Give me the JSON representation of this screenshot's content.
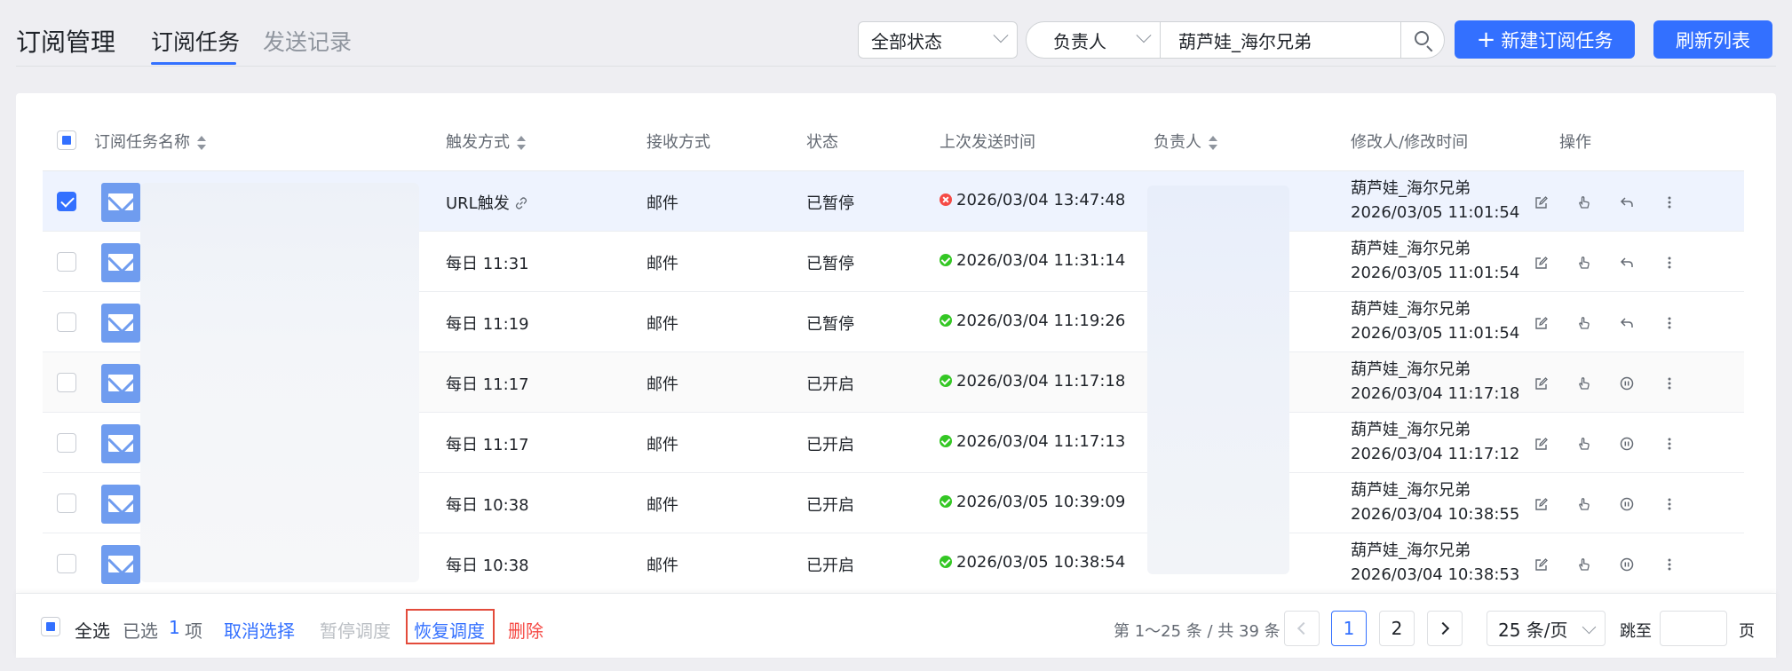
{
  "header": {
    "app_title": "订阅管理",
    "tabs": [
      {
        "label": "订阅任务",
        "active": true
      },
      {
        "label": "发送记录",
        "active": false
      }
    ]
  },
  "filters": {
    "status_select": "全部状态",
    "owner_select": "负责人",
    "owner_value": "葫芦娃_海尔兄弟",
    "new_button": "新建订阅任务",
    "new_button_icon": "plus-icon",
    "refresh_button": "刷新列表"
  },
  "table": {
    "columns": [
      "订阅任务名称",
      "触发方式",
      "接收方式",
      "状态",
      "上次发送时间",
      "负责人",
      "修改人/修改时间",
      "操作"
    ],
    "rows": [
      {
        "checked": true,
        "trigger": "URL触发",
        "receive": "邮件",
        "status": "已暂停",
        "last_send_ok": false,
        "last_send": "2026/03/04 13:47:48",
        "modifier": "葫芦娃_海尔兄弟",
        "modified": "2026/03/05 11:01:54",
        "action3": "resume"
      },
      {
        "checked": false,
        "trigger": "每日 11:31",
        "receive": "邮件",
        "status": "已暂停",
        "last_send_ok": true,
        "last_send": "2026/03/04 11:31:14",
        "modifier": "葫芦娃_海尔兄弟",
        "modified": "2026/03/05 11:01:54",
        "action3": "resume"
      },
      {
        "checked": false,
        "trigger": "每日 11:19",
        "receive": "邮件",
        "status": "已暂停",
        "last_send_ok": true,
        "last_send": "2026/03/04 11:19:26",
        "modifier": "葫芦娃_海尔兄弟",
        "modified": "2026/03/05 11:01:54",
        "action3": "resume"
      },
      {
        "checked": false,
        "trigger": "每日 11:17",
        "receive": "邮件",
        "status": "已开启",
        "last_send_ok": true,
        "last_send": "2026/03/04 11:17:18",
        "modifier": "葫芦娃_海尔兄弟",
        "modified": "2026/03/04 11:17:18",
        "action3": "pause"
      },
      {
        "checked": false,
        "trigger": "每日 11:17",
        "receive": "邮件",
        "status": "已开启",
        "last_send_ok": true,
        "last_send": "2026/03/04 11:17:13",
        "modifier": "葫芦娃_海尔兄弟",
        "modified": "2026/03/04 11:17:12",
        "action3": "pause"
      },
      {
        "checked": false,
        "trigger": "每日 10:38",
        "receive": "邮件",
        "status": "已开启",
        "last_send_ok": true,
        "last_send": "2026/03/05 10:39:09",
        "modifier": "葫芦娃_海尔兄弟",
        "modified": "2026/03/04 10:38:55",
        "action3": "pause"
      },
      {
        "checked": false,
        "trigger": "每日 10:38",
        "receive": "邮件",
        "status": "已开启",
        "last_send_ok": true,
        "last_send": "2026/03/05 10:38:54",
        "modifier": "葫芦娃_海尔兄弟",
        "modified": "2026/03/04 10:38:53",
        "action3": "pause"
      }
    ]
  },
  "footer": {
    "select_all": "全选",
    "selected_prefix": "已选",
    "selected_count": "1",
    "selected_suffix": "项",
    "cancel_selection": "取消选择",
    "pause_schedule": "暂停调度",
    "resume_schedule": "恢复调度",
    "delete": "删除",
    "page_info": "第 1～25 条 / 共 39 条",
    "pages": [
      "1",
      "2"
    ],
    "page_size": "25 条/页",
    "jump_to": "跳至",
    "page_unit": "页"
  },
  "colors": {
    "accent": "#3370ff",
    "danger": "#f54a45",
    "success": "#34c724",
    "highlight_box": "#e34b3b"
  }
}
